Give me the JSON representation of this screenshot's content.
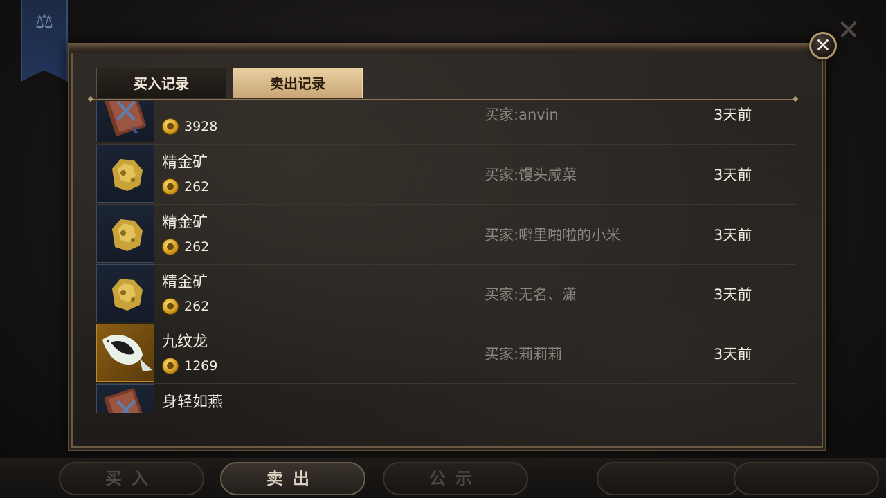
{
  "tabs": {
    "buy_record": "买入记录",
    "sell_record": "卖出记录"
  },
  "close_label": "✕",
  "records": [
    {
      "name": "",
      "price": "3928",
      "buyer": "买家:anvin",
      "time": "3天前",
      "icon": "skill-book-icon"
    },
    {
      "name": "精金矿",
      "price": "262",
      "buyer": "买家:馒头咸菜",
      "time": "3天前",
      "icon": "gold-ore-icon"
    },
    {
      "name": "精金矿",
      "price": "262",
      "buyer": "买家:噼里啪啦的小米",
      "time": "3天前",
      "icon": "gold-ore-icon"
    },
    {
      "name": "精金矿",
      "price": "262",
      "buyer": "买家:无名、潇",
      "time": "3天前",
      "icon": "gold-ore-icon"
    },
    {
      "name": "九纹龙",
      "price": "1269",
      "buyer": "买家:莉莉莉",
      "time": "3天前",
      "icon": "fish-icon"
    },
    {
      "name": "身轻如燕",
      "price": "",
      "buyer": "",
      "time": "",
      "icon": "skill-book-icon"
    }
  ],
  "bottom_nav": {
    "buy": "买入",
    "sell": "卖出",
    "notice": "公示"
  },
  "colors": {
    "accent": "#c9a676",
    "panel": "#1f1c19",
    "buyer_text": "#8c8680"
  }
}
